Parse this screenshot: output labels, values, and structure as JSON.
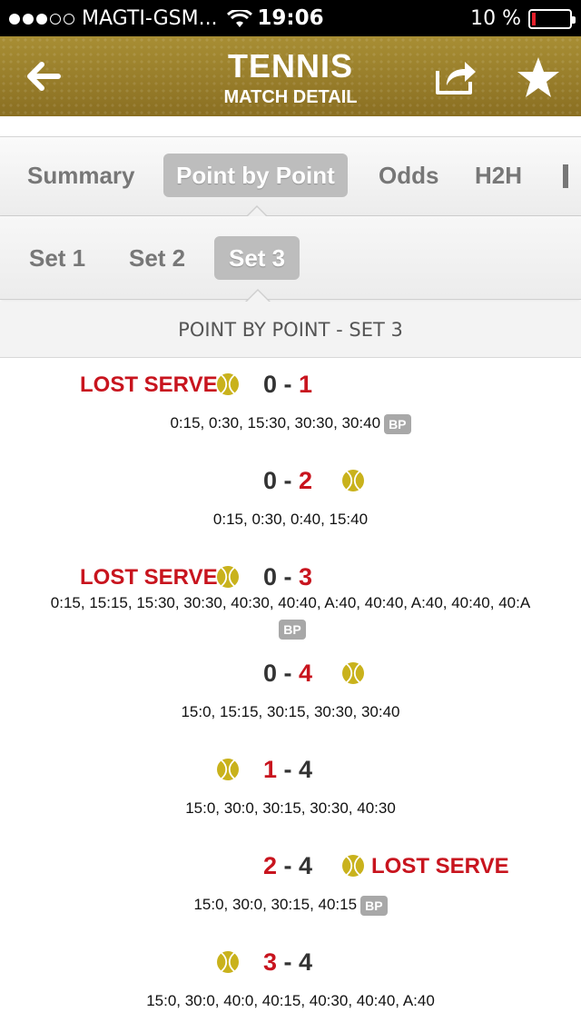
{
  "status_bar": {
    "carrier": "MAGTI-GSM...",
    "time": "19:06",
    "battery": "10 %",
    "battery_level": 0.1
  },
  "header": {
    "title": "TENNIS",
    "subtitle": "MATCH DETAIL"
  },
  "tabs": [
    {
      "label": "Summary"
    },
    {
      "label": "Point by Point"
    },
    {
      "label": "Odds"
    },
    {
      "label": "H2H"
    }
  ],
  "active_tab": "Point by Point",
  "sets": [
    {
      "label": "Set 1"
    },
    {
      "label": "Set 2"
    },
    {
      "label": "Set 3"
    }
  ],
  "active_set": "Set 3",
  "section_title": "POINT BY POINT - SET 3",
  "lost_serve_label": "LOST SERVE",
  "bp_label": "BP",
  "colors": {
    "header_gold": "#9a7e2a",
    "accent_red": "#c8141e",
    "ball_yellow": "#c9b21c"
  },
  "games": [
    {
      "home": "0",
      "away": "1",
      "server": "home",
      "lost_serve": "home",
      "changed": "away",
      "points": "0:15, 0:30, 15:30, 30:30, 30:40",
      "bp": true
    },
    {
      "home": "0",
      "away": "2",
      "server": "away",
      "lost_serve": "",
      "changed": "away",
      "points": "0:15, 0:30, 0:40, 15:40",
      "bp": false
    },
    {
      "home": "0",
      "away": "3",
      "server": "home",
      "lost_serve": "home",
      "changed": "away",
      "points": "0:15, 15:15, 15:30, 30:30, 40:30, 40:40, A:40, 40:40, A:40, 40:40, 40:A",
      "bp": true
    },
    {
      "home": "0",
      "away": "4",
      "server": "away",
      "lost_serve": "",
      "changed": "away",
      "points": "15:0, 15:15, 30:15, 30:30, 30:40",
      "bp": false
    },
    {
      "home": "1",
      "away": "4",
      "server": "home",
      "lost_serve": "",
      "changed": "home",
      "points": "15:0, 30:0, 30:15, 30:30, 40:30",
      "bp": false
    },
    {
      "home": "2",
      "away": "4",
      "server": "away",
      "lost_serve": "away",
      "changed": "home",
      "points": "15:0, 30:0, 30:15, 40:15",
      "bp": true
    },
    {
      "home": "3",
      "away": "4",
      "server": "home",
      "lost_serve": "",
      "changed": "home",
      "points": "15:0, 30:0, 40:0, 40:15, 40:30, 40:40, A:40",
      "bp": false
    }
  ]
}
